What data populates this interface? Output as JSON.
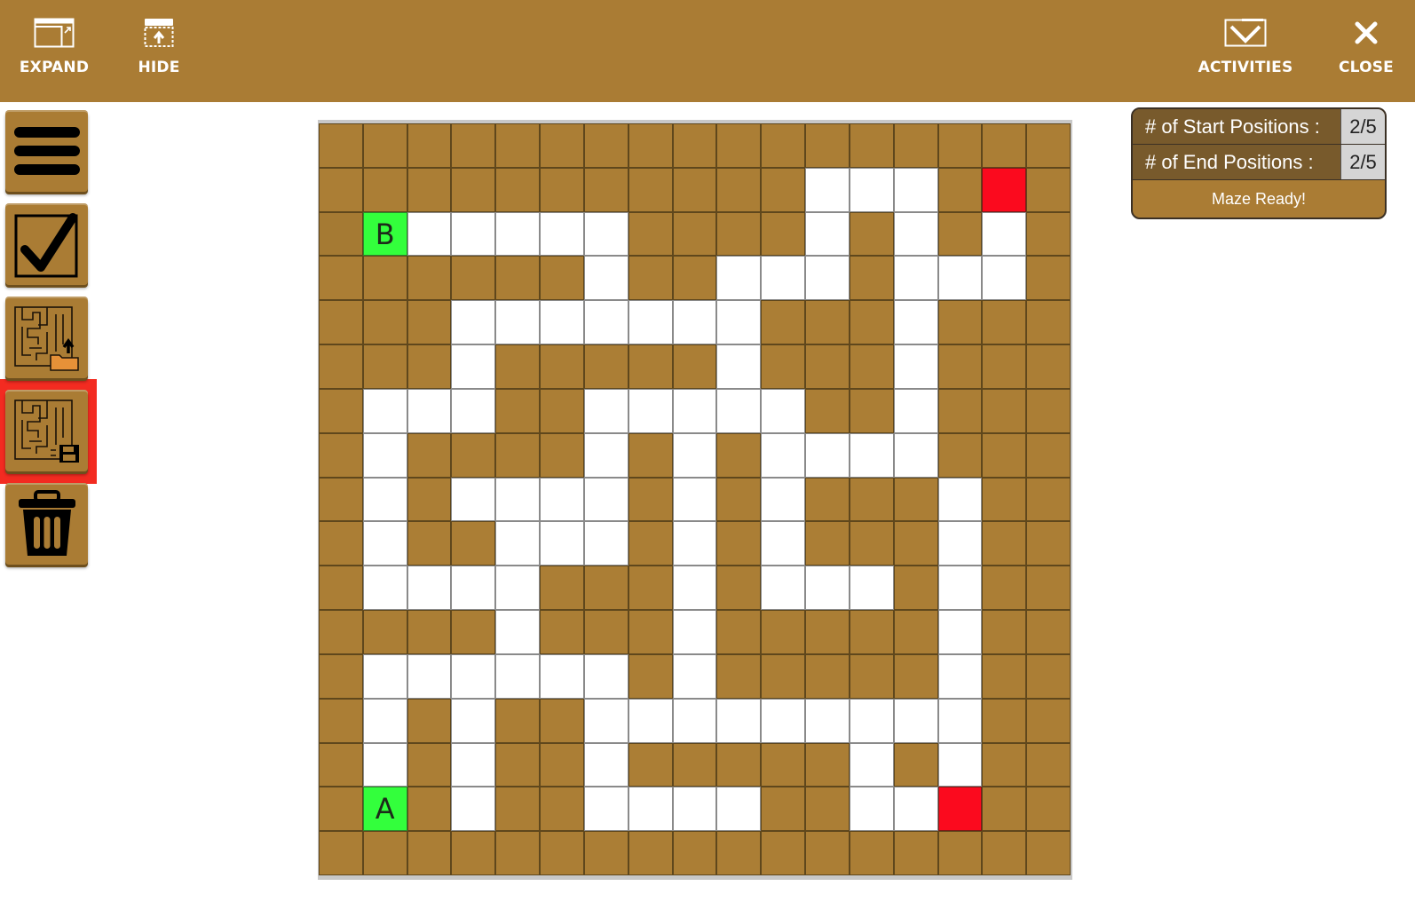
{
  "toolbar": {
    "expand_label": "EXPAND",
    "hide_label": "HIDE",
    "activities_label": "ACTIVITIES",
    "close_label": "CLOSE"
  },
  "sidebar": {
    "items": [
      {
        "name": "menu-button",
        "icon": "hamburger-menu-icon"
      },
      {
        "name": "check-button",
        "icon": "checkbox-checked-icon"
      },
      {
        "name": "load-maze-button",
        "icon": "maze-open-folder-icon"
      },
      {
        "name": "save-maze-button",
        "icon": "maze-save-disk-icon",
        "selected": true
      },
      {
        "name": "delete-button",
        "icon": "trash-can-icon"
      }
    ]
  },
  "status_panel": {
    "start_label": "# of Start Positions :",
    "start_value": "2/5",
    "end_label": "# of End Positions :",
    "end_value": "2/5",
    "message": "Maze Ready!"
  },
  "maze": {
    "rows": 17,
    "cols": 17,
    "legend": {
      "W": "wall",
      ".": "path",
      "A": "start",
      "B": "start",
      "E": "end"
    },
    "grid": [
      "WWWWWWWWWWWWWWWWW",
      "WWWWWWWWWWW...WEW",
      "WB.....WWWW.W.W.W",
      "WWWWWW.WW...W...W",
      "WWW.......WWW.WWW",
      "WWW.WWWWW.WWW.WWW",
      "W...WW.....WW.WWW",
      "W.WWWW.W.W....WWW",
      "W.W....W.W.WWW.WW",
      "W.WW...W.W.WWW.WW",
      "W....WWW.W...W.WW",
      "WWWW.WWW.WWWWW.WW",
      "W......W.WWWWW.WW",
      "W.W.WW.........WW",
      "W.W.WW.WWWWW.W.WW",
      "WAW.WW....WW..EWW",
      "WWWWWWWWWWWWWWWWW"
    ],
    "start_labels": {
      "A": "A",
      "B": "B"
    },
    "colors": {
      "wall": "#ab7e35",
      "path": "#ffffff",
      "start": "#33ff3c",
      "end": "#fb0a1e"
    }
  },
  "colors": {
    "brand": "#aa7c34",
    "selection": "#f32b21"
  }
}
